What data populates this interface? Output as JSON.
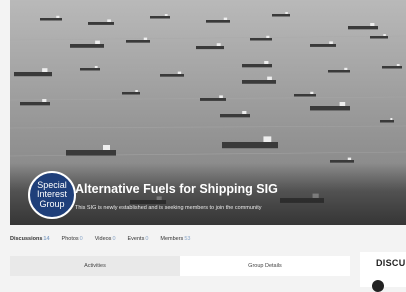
{
  "group": {
    "badge_lines": [
      "Special",
      "Interest",
      "Group"
    ],
    "title": "Alternative Fuels for Shipping SIG",
    "subtitle": "This SIG is newly established and is seeking members to join the community"
  },
  "tabs": [
    {
      "label": "Discussions",
      "count": "14"
    },
    {
      "label": "Photos",
      "count": "0"
    },
    {
      "label": "Videos",
      "count": "0"
    },
    {
      "label": "Events",
      "count": "0"
    },
    {
      "label": "Members",
      "count": "53"
    }
  ],
  "subtabs": {
    "activities": "Activities",
    "group_details": "Group Details"
  },
  "discussions_panel": {
    "title": "DISCU"
  },
  "colors": {
    "badge": "#1f3f7a",
    "count": "#8aa6c8",
    "sea": "#8f8f8f"
  }
}
